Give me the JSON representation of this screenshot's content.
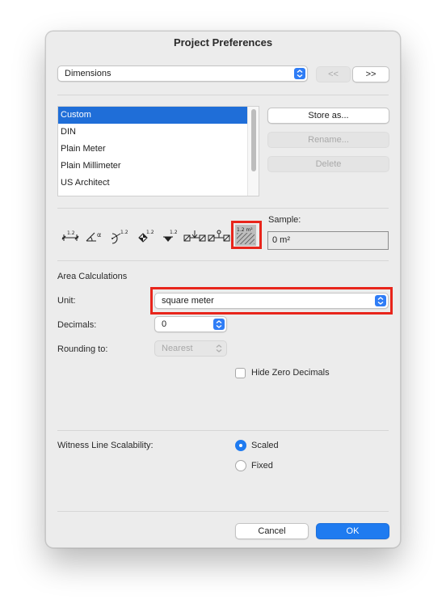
{
  "window": {
    "title": "Project Preferences"
  },
  "top": {
    "category_value": "Dimensions",
    "prev_label": "<<",
    "next_label": ">>"
  },
  "presets": {
    "items": [
      "Custom",
      "DIN",
      "Plain Meter",
      "Plain Millimeter",
      "US Architect"
    ],
    "selected_index": 0,
    "store_label": "Store as...",
    "rename_label": "Rename...",
    "delete_label": "Delete"
  },
  "toolbar": {
    "icons": [
      {
        "name": "linear-dimension-icon",
        "text": "1.2"
      },
      {
        "name": "angle-dimension-icon",
        "text": "α"
      },
      {
        "name": "radial-dimension-icon",
        "text": "1.2"
      },
      {
        "name": "level-dimension-icon",
        "text": "1.2"
      },
      {
        "name": "elevation-dimension-icon",
        "text": "1.2"
      },
      {
        "name": "door-window-dimension-icon",
        "text": ""
      },
      {
        "name": "sill-height-dimension-icon",
        "text": ""
      },
      {
        "name": "area-calculation-icon",
        "text": "1.2 m²"
      }
    ],
    "selected": "area-calculation-icon"
  },
  "sample": {
    "label": "Sample:",
    "value": "0 m²"
  },
  "area": {
    "section_title": "Area Calculations",
    "unit_label": "Unit:",
    "unit_value": "square meter",
    "decimals_label": "Decimals:",
    "decimals_value": "0",
    "rounding_label": "Rounding to:",
    "rounding_value": "Nearest",
    "hide_zero_label": "Hide Zero Decimals",
    "hide_zero_checked": false
  },
  "witness": {
    "label": "Witness Line Scalability:",
    "options": [
      "Scaled",
      "Fixed"
    ],
    "selected": "Scaled"
  },
  "footer": {
    "cancel_label": "Cancel",
    "ok_label": "OK"
  },
  "colors": {
    "accent": "#1f7bf0",
    "highlight": "#e8251b",
    "selection": "#1f6ed8"
  }
}
